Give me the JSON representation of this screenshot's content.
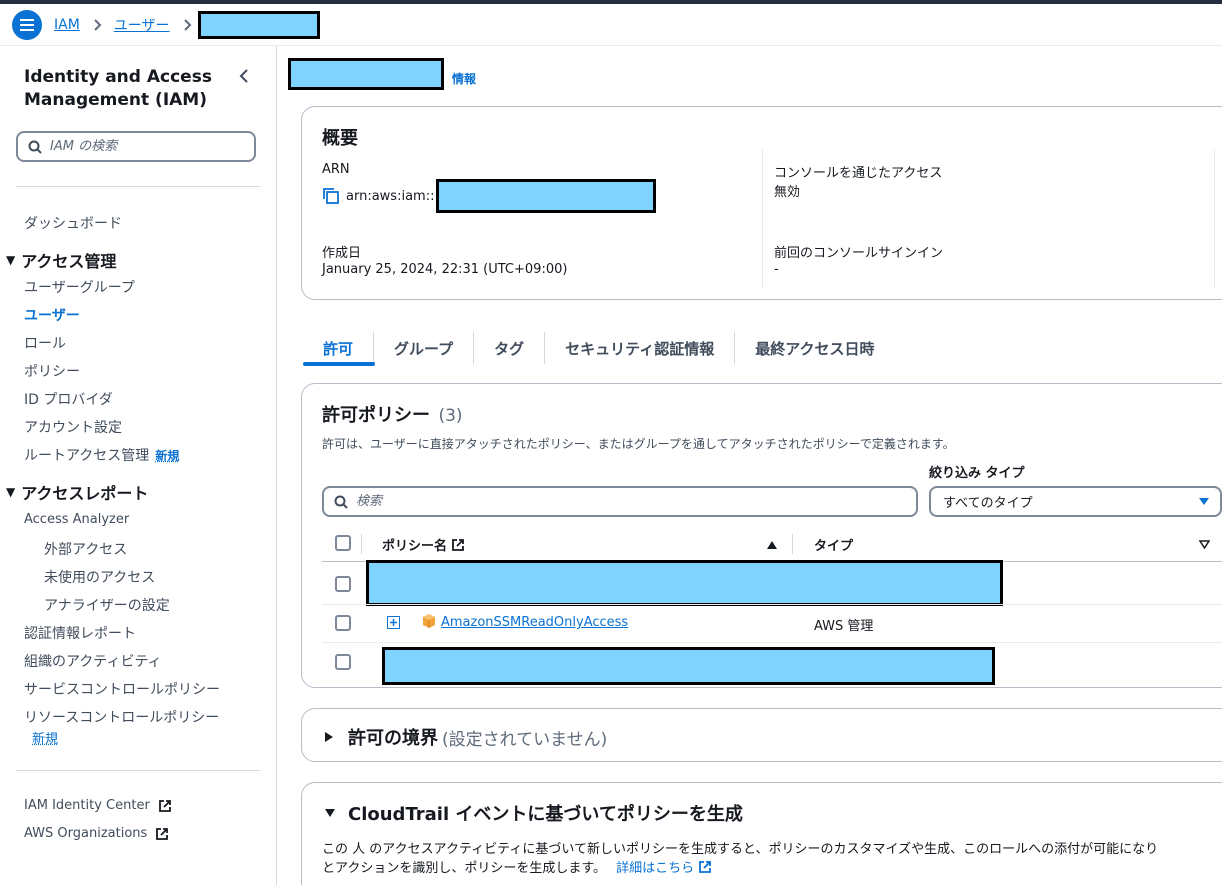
{
  "breadcrumb": {
    "items": [
      "IAM",
      "ユーザー"
    ]
  },
  "sidebar": {
    "title": "Identity and Access Management (IAM)",
    "search_placeholder": "IAM の検索",
    "dashboard": "ダッシュボード",
    "access_management": {
      "label": "アクセス管理",
      "items": [
        "ユーザーグループ",
        "ユーザー",
        "ロール",
        "ポリシー",
        "ID プロバイダ",
        "アカウント設定",
        "ルートアクセス管理"
      ]
    },
    "access_reports": {
      "label": "アクセスレポート",
      "items": [
        "Access Analyzer",
        "外部アクセス",
        "未使用のアクセス",
        "アナライザーの設定",
        "認証情報レポート",
        "組織のアクティビティ",
        "サービスコントロールポリシー",
        "リソースコントロールポリシー"
      ]
    },
    "new_badge": "新規",
    "external": [
      "IAM Identity Center",
      "AWS Organizations"
    ]
  },
  "page": {
    "info": "情報"
  },
  "summary": {
    "heading": "概要",
    "arn_label": "ARN",
    "arn_prefix": "arn:aws:iam::",
    "created_label": "作成日",
    "created_value": "January 25, 2024, 22:31 (UTC+09:00)",
    "console_access_label": "コンソールを通じたアクセス",
    "console_access_value": "無効",
    "last_signin_label": "前回のコンソールサインイン",
    "last_signin_value": "-"
  },
  "tabs": [
    "許可",
    "グループ",
    "タグ",
    "セキュリティ認証情報",
    "最終アクセス日時"
  ],
  "policies": {
    "heading": "許可ポリシー",
    "count": "(3)",
    "description": "許可は、ユーザーに直接アタッチされたポリシー、またはグループを通してアタッチされたポリシーで定義されます。",
    "filter_type_label": "絞り込み タイプ",
    "search_placeholder": "検索",
    "type_select_value": "すべてのタイプ",
    "col_name": "ポリシー名",
    "col_type": "タイプ",
    "rows": [
      {
        "name": "AmazonSSMReadOnlyAccess",
        "type": "AWS 管理"
      }
    ]
  },
  "boundary": {
    "heading": "許可の境界",
    "status": "(設定されていません)"
  },
  "cloudtrail": {
    "heading": "CloudTrail イベントに基づいてポリシーを生成",
    "description_line1": "この 人 のアクセスアクティビティに基づいて新しいポリシーを生成すると、ポリシーのカスタマイズや生成、このロールへの添付が可能になり",
    "description_line2": "とアクションを識別し、ポリシーを生成します。",
    "learn_more": "詳細はこちら"
  },
  "colors": {
    "accent": "#0972d3",
    "redaction": "#7fd3ff"
  }
}
